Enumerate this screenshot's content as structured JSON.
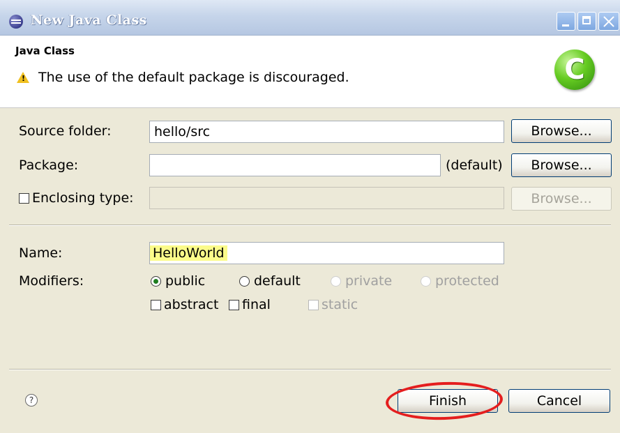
{
  "window": {
    "title": "New Java Class",
    "controls": [
      "minimize-icon",
      "maximize-icon",
      "close-icon"
    ]
  },
  "banner": {
    "title": "Java Class",
    "message": "The use of the default package is discouraged.",
    "class_icon_letter": "C",
    "warning_icon": "warning-triangle-icon"
  },
  "fields": {
    "source_folder": {
      "label": "Source folder:",
      "value": "hello/src",
      "button": "Browse..."
    },
    "package": {
      "label": "Package:",
      "value": "",
      "hint": "(default)",
      "button": "Browse..."
    },
    "enclosing_type": {
      "label": "Enclosing type:",
      "value": "",
      "checked": false,
      "button": "Browse..."
    },
    "name": {
      "label": "Name:",
      "value": "HelloWorld"
    }
  },
  "modifiers": {
    "label": "Modifiers:",
    "visibility": [
      "public",
      "default",
      "private",
      "protected"
    ],
    "selected": "public",
    "flags": [
      "abstract",
      "final",
      "static"
    ]
  },
  "footer": {
    "help_icon_glyph": "?",
    "finish_label": "Finish",
    "cancel_label": "Cancel"
  },
  "annotation_color": "#e41e1e"
}
